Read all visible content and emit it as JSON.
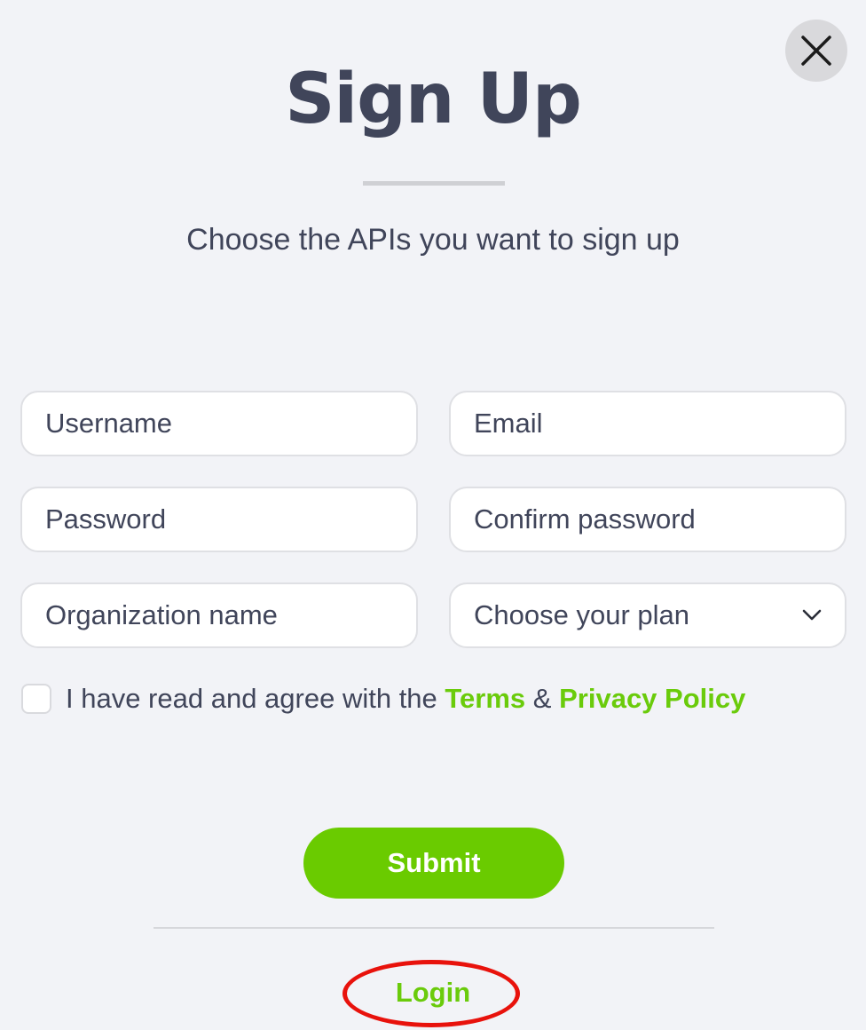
{
  "dialog": {
    "title": "Sign Up",
    "subtitle": "Choose the APIs you want to sign up",
    "close_icon": "close-icon"
  },
  "form": {
    "username_placeholder": "Username",
    "email_placeholder": "Email",
    "password_placeholder": "Password",
    "confirm_password_placeholder": "Confirm password",
    "organization_placeholder": "Organization name",
    "plan_select_label": "Choose your plan",
    "plan_select_icon": "chevron-down-icon"
  },
  "terms": {
    "prefix": "I have read and agree with the",
    "terms_link": "Terms",
    "ampersand": "&",
    "privacy_link": "Privacy Policy"
  },
  "actions": {
    "submit_label": "Submit",
    "login_label": "Login"
  },
  "colors": {
    "accent_green": "#6acb00",
    "text_dark": "#40455a",
    "background": "#f2f3f7",
    "highlight_red": "#e8120c"
  }
}
